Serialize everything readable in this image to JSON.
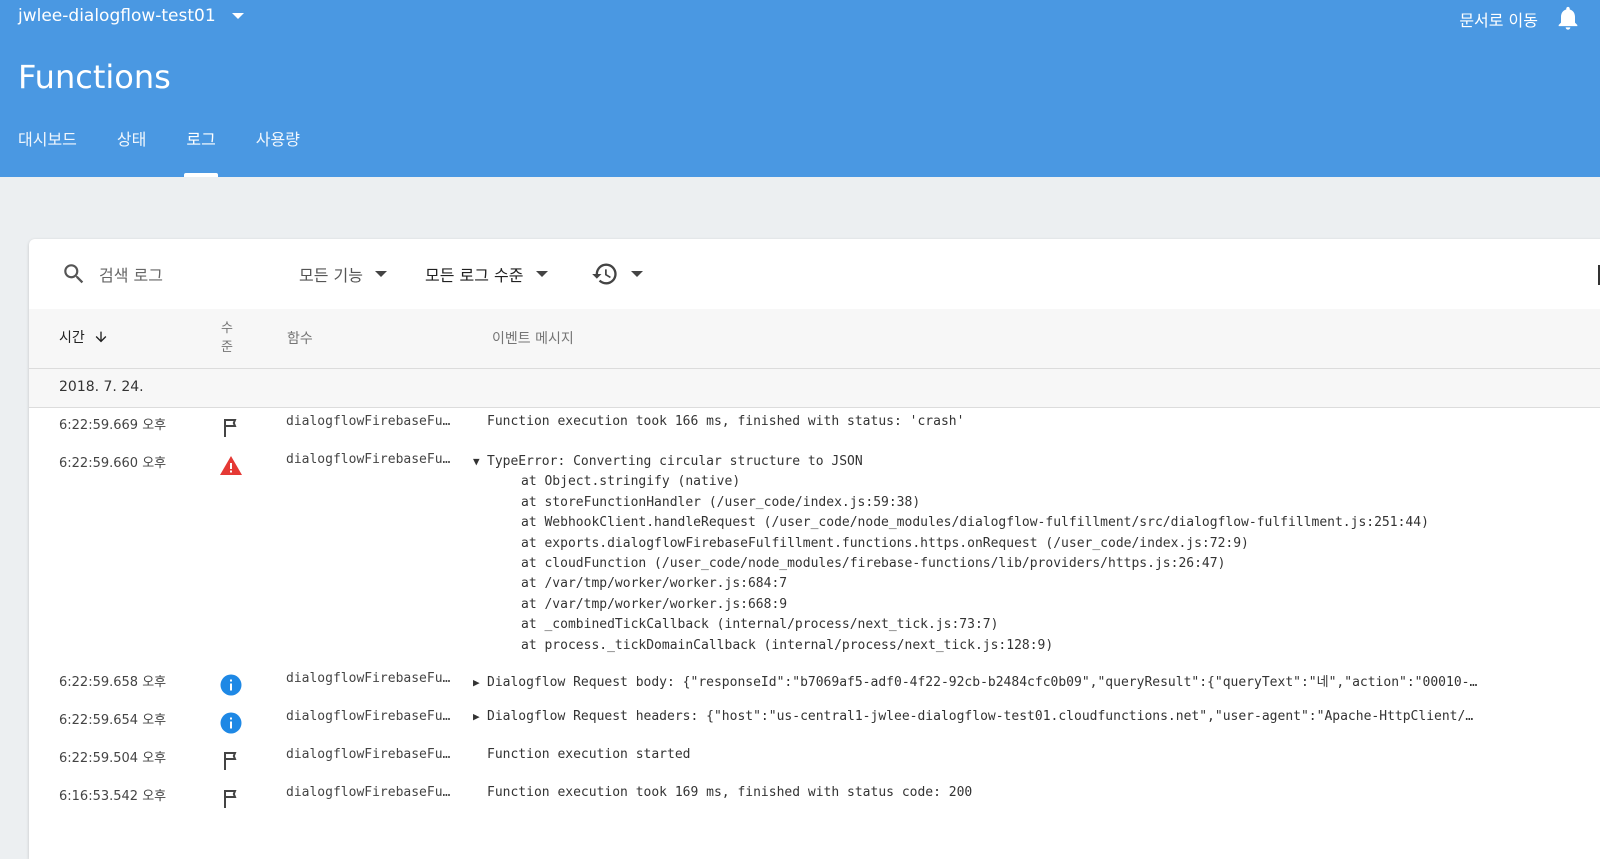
{
  "header": {
    "project_name": "jwlee-dialogflow-test01",
    "docs_link": "문서로 이동",
    "title": "Functions",
    "tabs": [
      {
        "label": "대시보드"
      },
      {
        "label": "상태"
      },
      {
        "label": "로그"
      },
      {
        "label": "사용량"
      }
    ],
    "active_tab": "로그",
    "accent_color": "#4a98e2"
  },
  "toolbar": {
    "search_placeholder": "검색 로그",
    "function_filter": "모든 기능",
    "level_filter": "모든 로그 수준",
    "history_icon": "history-icon"
  },
  "table": {
    "columns": {
      "time": "시간",
      "level_line1": "수",
      "level_line2": "준",
      "function": "함수",
      "message": "이벤트 메시지"
    },
    "date": "2018. 7. 24.",
    "rows": [
      {
        "time": "6:22:59.669 오후",
        "level": "flag-icon",
        "function": "dialogflowFirebaseFulfillment",
        "message": "Function execution took 166 ms, finished with status: 'crash'"
      },
      {
        "time": "6:22:59.660 오후",
        "level": "error-icon",
        "function": "dialogflowFirebaseFulfillment",
        "message": "TypeError: Converting circular structure to JSON",
        "stack": [
          "at Object.stringify (native)",
          "at storeFunctionHandler (/user_code/index.js:59:38)",
          "at WebhookClient.handleRequest (/user_code/node_modules/dialogflow-fulfillment/src/dialogflow-fulfillment.js:251:44)",
          "at exports.dialogflowFirebaseFulfillment.functions.https.onRequest (/user_code/index.js:72:9)",
          "at cloudFunction (/user_code/node_modules/firebase-functions/lib/providers/https.js:26:47)",
          "at /var/tmp/worker/worker.js:684:7",
          "at /var/tmp/worker/worker.js:668:9",
          "at _combinedTickCallback (internal/process/next_tick.js:73:7)",
          "at process._tickDomainCallback (internal/process/next_tick.js:128:9)"
        ]
      },
      {
        "time": "6:22:59.658 오후",
        "level": "info-icon",
        "function": "dialogflowFirebaseFulfillment",
        "message": "Dialogflow Request body: {\"responseId\":\"b7069af5-adf0-4f22-92cb-b2484cfc0b09\",\"queryResult\":{\"queryText\":\"네\",\"action\":\"00010-…"
      },
      {
        "time": "6:22:59.654 오후",
        "level": "info-icon",
        "function": "dialogflowFirebaseFulfillment",
        "message": "Dialogflow Request headers: {\"host\":\"us-central1-jwlee-dialogflow-test01.cloudfunctions.net\",\"user-agent\":\"Apache-HttpClient/…"
      },
      {
        "time": "6:22:59.504 오후",
        "level": "flag-icon",
        "function": "dialogflowFirebaseFulfillment",
        "message": "Function execution started"
      },
      {
        "time": "6:16:53.542 오후",
        "level": "flag-icon",
        "function": "dialogflowFirebaseFulfillment",
        "message": "Function execution took 169 ms, finished with status code: 200"
      }
    ]
  },
  "colors": {
    "error": "#e53935",
    "info": "#1e88e5",
    "background": "#eceff1"
  }
}
